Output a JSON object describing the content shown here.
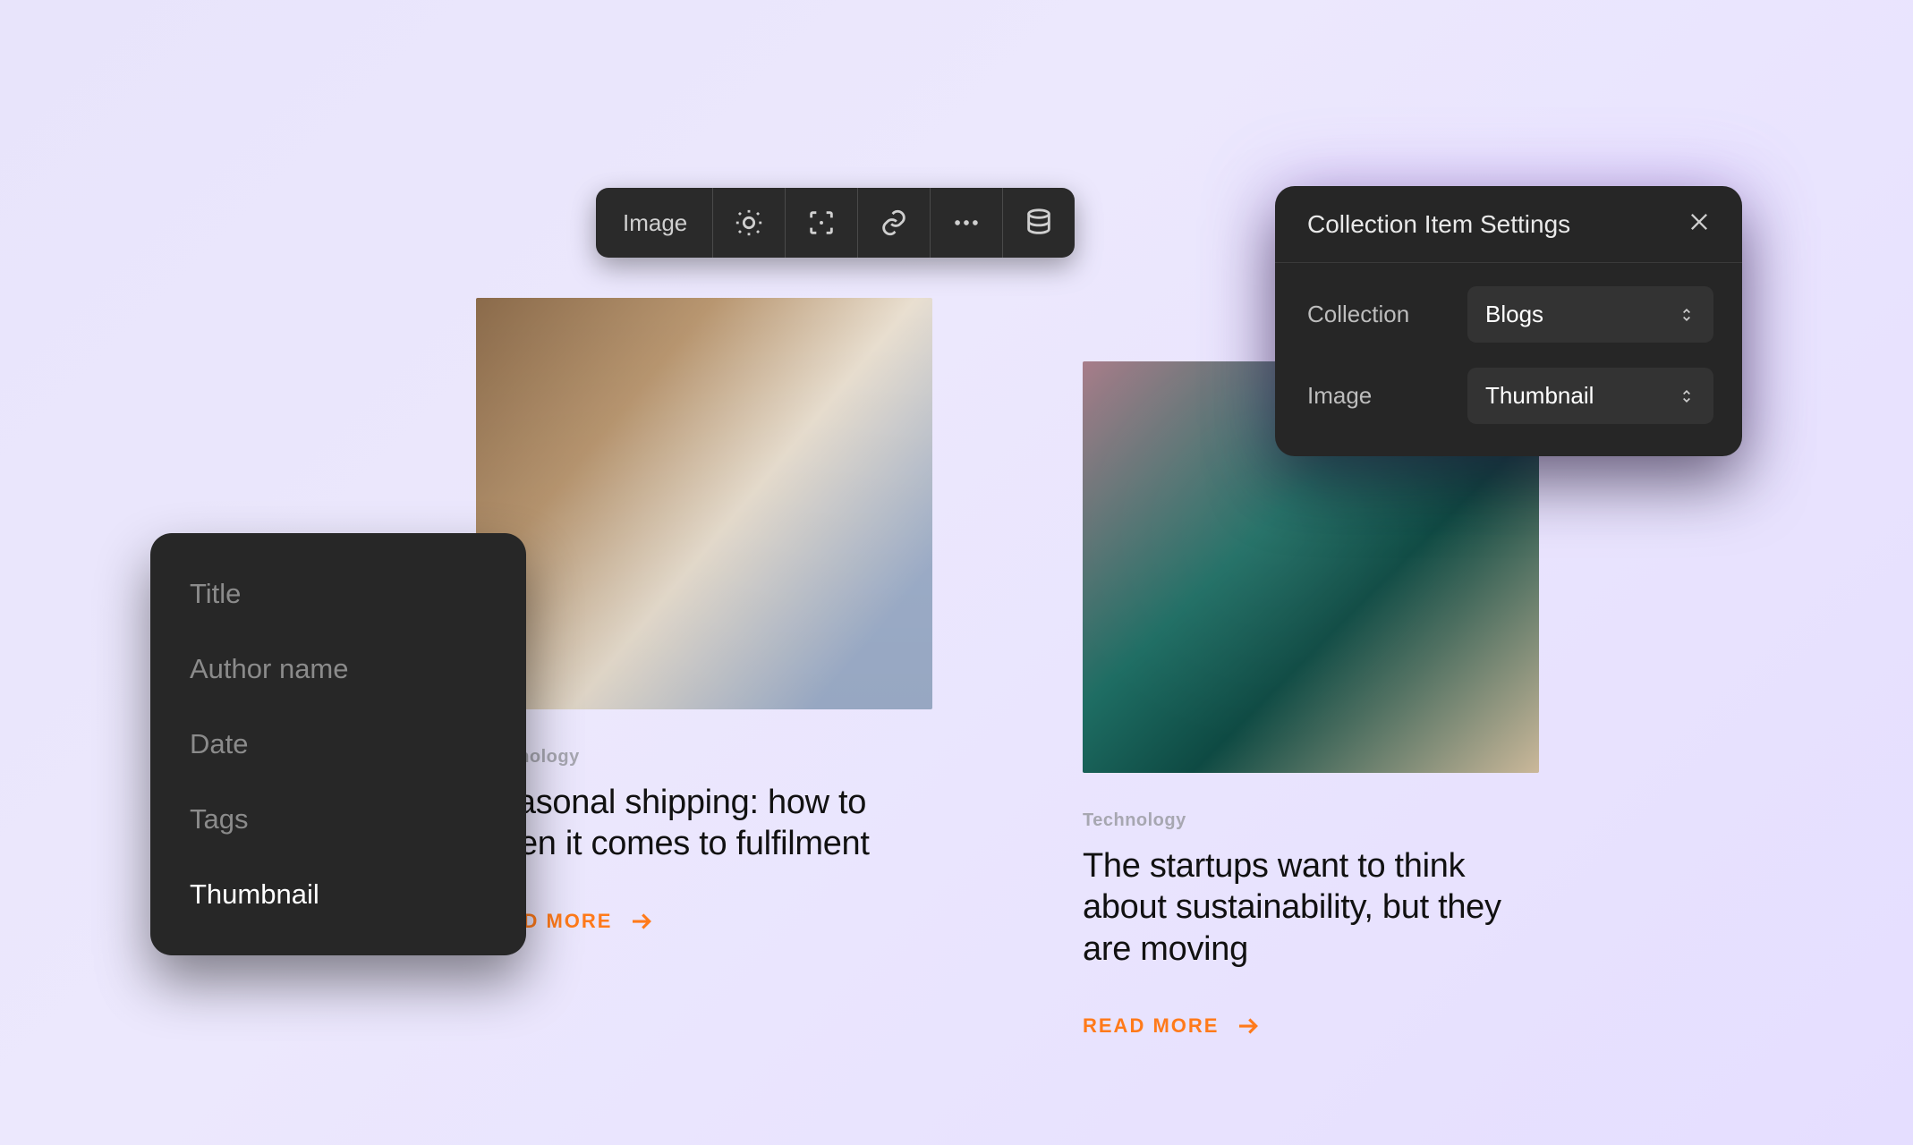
{
  "toolbar": {
    "label": "Image"
  },
  "dropdown": {
    "items": [
      {
        "label": "Title",
        "selected": false
      },
      {
        "label": "Author name",
        "selected": false
      },
      {
        "label": "Date",
        "selected": false
      },
      {
        "label": "Tags",
        "selected": false
      },
      {
        "label": "Thumbnail",
        "selected": true
      }
    ]
  },
  "panel": {
    "title": "Collection Item Settings",
    "fields": [
      {
        "label": "Collection",
        "value": "Blogs"
      },
      {
        "label": "Image",
        "value": "Thumbnail"
      }
    ]
  },
  "cards": [
    {
      "category": "Technology",
      "title": "Seasonal shipping: how to when it comes to fulfilment",
      "cta": "READ MORE"
    },
    {
      "category": "Technology",
      "title": "The startups want to think about sustainability, but they are moving",
      "cta": "READ MORE"
    }
  ]
}
